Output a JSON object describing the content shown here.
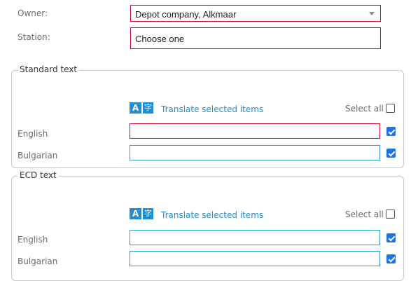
{
  "owner": {
    "label": "Owner:",
    "value": "Depot company, Alkmaar"
  },
  "station": {
    "label": "Station:",
    "value": "Choose one"
  },
  "standard_text": {
    "title": "Standard text",
    "translate_label": "Translate selected items",
    "select_all_label": "Select all",
    "select_all_checked": false,
    "rows": [
      {
        "lang": "English",
        "value": "",
        "checked": true,
        "state": "error"
      },
      {
        "lang": "Bulgarian",
        "value": "",
        "checked": true,
        "state": "normal"
      }
    ]
  },
  "ecd_text": {
    "title": "ECD text",
    "translate_label": "Translate selected items",
    "select_all_label": "Select all",
    "select_all_checked": false,
    "rows": [
      {
        "lang": "English",
        "value": "",
        "checked": true,
        "state": "normal"
      },
      {
        "lang": "Bulgarian",
        "value": "",
        "checked": true,
        "state": "normal"
      }
    ]
  },
  "icons": {
    "translate": "translate-icon",
    "dropdown": "chevron-down-icon",
    "check": "checkbox-check-icon"
  },
  "colors": {
    "error_border": "#c8102e",
    "input_border": "#2a9dc8",
    "link": "#1f8ed4",
    "checkbox": "#1a73e8"
  }
}
